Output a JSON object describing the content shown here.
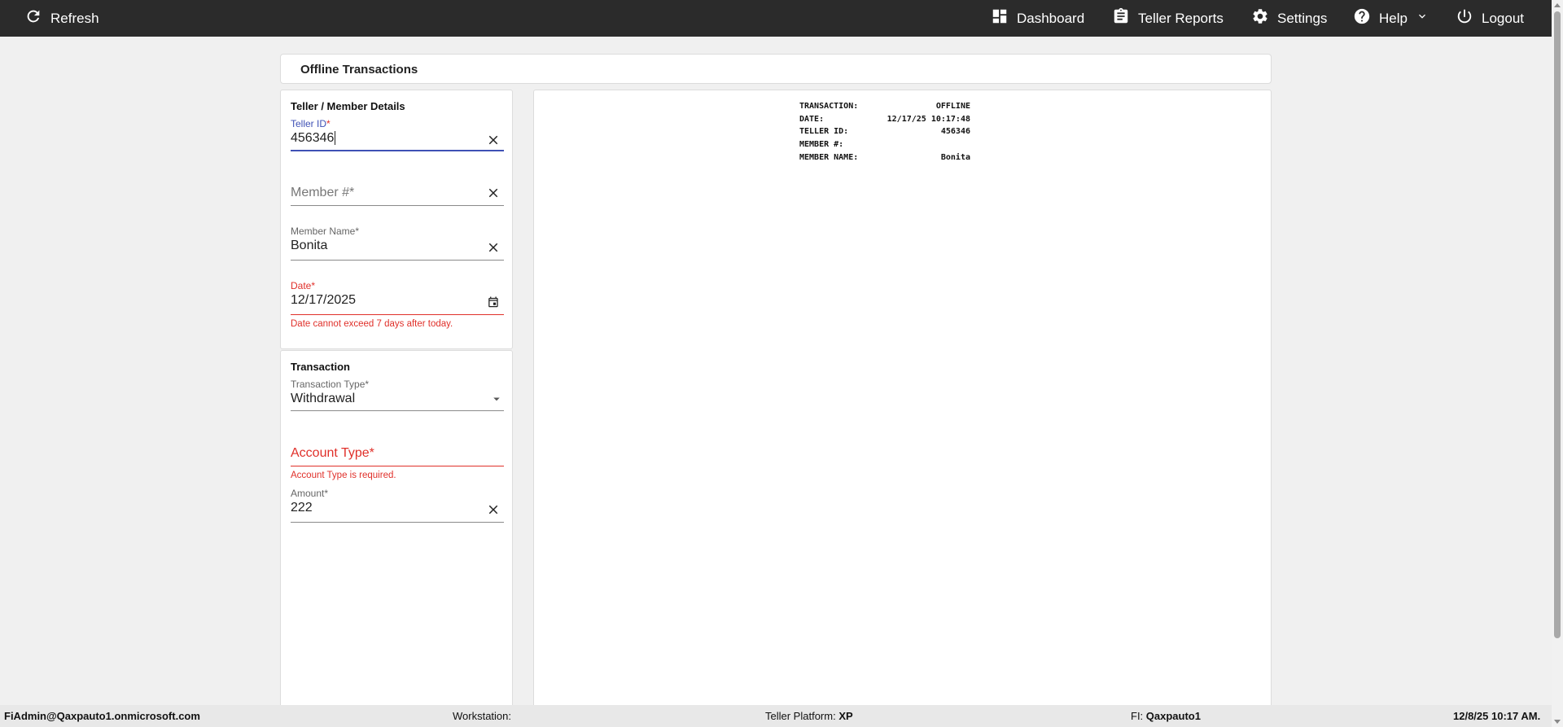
{
  "topbar": {
    "refresh_label": "Refresh",
    "nav": {
      "dashboard": "Dashboard",
      "teller_reports": "Teller Reports",
      "settings": "Settings",
      "help": "Help",
      "logout": "Logout"
    },
    "background_color": "#2b2b2b"
  },
  "page": {
    "title": "Offline Transactions"
  },
  "details": {
    "title": "Teller / Member Details",
    "teller_id": {
      "label": "Teller ID",
      "required_mark": "*",
      "value": "456346"
    },
    "member_number": {
      "placeholder": "Member #*"
    },
    "member_name": {
      "label": "Member Name*",
      "value": "Bonita"
    },
    "date": {
      "label": "Date*",
      "value": "12/17/2025",
      "error": "Date cannot exceed 7 days after today."
    }
  },
  "transaction": {
    "title": "Transaction",
    "type": {
      "label": "Transaction Type*",
      "value": "Withdrawal"
    },
    "account_type": {
      "placeholder": "Account Type*",
      "error": "Account Type is required."
    },
    "amount": {
      "label": "Amount*",
      "value": "222"
    }
  },
  "receipt": {
    "rows": [
      {
        "key": "TRANSACTION:",
        "value": "OFFLINE"
      },
      {
        "key": "DATE:",
        "value": "12/17/25 10:17:48"
      },
      {
        "key": "TELLER ID:",
        "value": "456346"
      },
      {
        "key": "MEMBER #:",
        "value": ""
      },
      {
        "key": "MEMBER NAME:",
        "value": "Bonita"
      }
    ]
  },
  "footer": {
    "user": "FiAdmin@Qaxpauto1.onmicrosoft.com",
    "workstation_label": "Workstation:",
    "workstation_value": "",
    "platform_label": "Teller Platform:",
    "platform_value": "XP",
    "fi_label": "FI:",
    "fi_value": "Qaxpauto1",
    "datetime": "12/8/25 10:17 AM."
  },
  "colors": {
    "accent": "#3f51b5",
    "error": "#e0302a"
  }
}
